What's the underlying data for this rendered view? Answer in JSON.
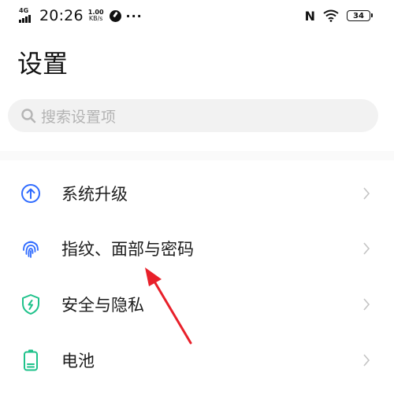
{
  "status_bar": {
    "network": "4G",
    "time": "20:26",
    "speed_value": "1.00",
    "speed_unit": "KB/s",
    "more": "···",
    "nfc": "N",
    "battery_level": "34"
  },
  "page_title": "设置",
  "search": {
    "placeholder": "搜索设置项"
  },
  "items": [
    {
      "label": "系统升级",
      "icon": "upgrade-arrow-icon",
      "color": "#2f6bff"
    },
    {
      "label": "指纹、面部与密码",
      "icon": "fingerprint-icon",
      "color": "#2f6bff"
    },
    {
      "label": "安全与隐私",
      "icon": "shield-icon",
      "color": "#1fc28b"
    },
    {
      "label": "电池",
      "icon": "battery-icon",
      "color": "#1fc28b"
    }
  ],
  "annotation": {
    "color": "#e8202a"
  }
}
